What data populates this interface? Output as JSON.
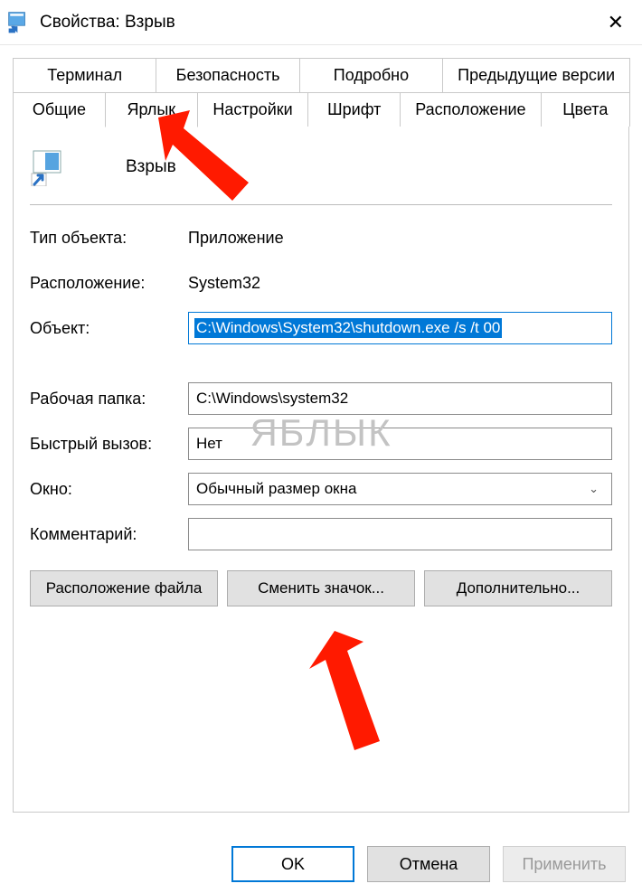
{
  "window": {
    "title": "Свойства: Взрыв"
  },
  "tabs": {
    "row1": [
      "Терминал",
      "Безопасность",
      "Подробно",
      "Предыдущие версии"
    ],
    "row2": [
      "Общие",
      "Ярлык",
      "Настройки",
      "Шрифт",
      "Расположение",
      "Цвета"
    ],
    "active": "Ярлык"
  },
  "shortcut": {
    "name": "Взрыв",
    "type_label": "Тип объекта:",
    "type_value": "Приложение",
    "location_label": "Расположение:",
    "location_value": "System32",
    "target_label": "Объект:",
    "target_value": "C:\\Windows\\System32\\shutdown.exe /s /t 00",
    "startin_label": "Рабочая папка:",
    "startin_value": "C:\\Windows\\system32",
    "hotkey_label": "Быстрый вызов:",
    "hotkey_value": "Нет",
    "run_label": "Окно:",
    "run_value": "Обычный размер окна",
    "comment_label": "Комментарий:",
    "comment_value": ""
  },
  "buttons": {
    "file_location": "Расположение файла",
    "change_icon": "Сменить значок...",
    "advanced": "Дополнительно...",
    "ok": "OK",
    "cancel": "Отмена",
    "apply": "Применить"
  },
  "watermark": "ЯБЛЫК"
}
